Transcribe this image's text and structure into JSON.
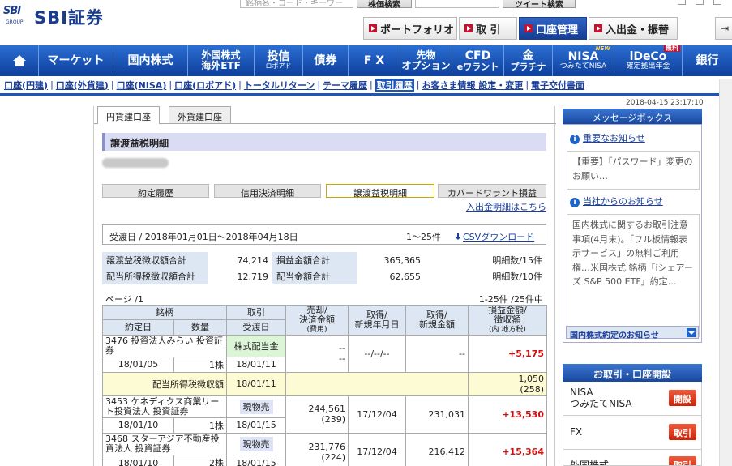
{
  "brand": {
    "logo_small": "SBI",
    "logo_group": "GROUP",
    "logo_text": "SBI証券"
  },
  "top_search": {
    "placeholder": "銘柄名・コード・キーワード",
    "button": "株価検索",
    "button2": "ツイート検索"
  },
  "subnav": {
    "portfolio": "ポートフォリオ",
    "trade": "取 引",
    "account": "口座管理",
    "deposit": "入出金・振替"
  },
  "mainnav": {
    "market": "マーケット",
    "domestic": "国内株式",
    "foreign_l1": "外国株式",
    "foreign_l2": "海外ETF",
    "trust_l1": "投信",
    "trust_l2": "ロボアド",
    "bond": "債券",
    "fx": "F X",
    "futures_l1": "先物",
    "futures_l2": "オプション",
    "cfd_l1": "CFD",
    "cfd_l2": "eワラント",
    "gold_l1": "金",
    "gold_l2": "プラチナ",
    "nisa_l1": "NISA",
    "nisa_l2": "つみたてNISA",
    "nisa_badge": "NEW",
    "ideco_l1": "iDeCo",
    "ideco_l2": "確定拠出年金",
    "ideco_badge": "無料",
    "bank": "銀行"
  },
  "acct_links": [
    "口座(円建)",
    "口座(外貨建)",
    "口座(NISA)",
    "口座(ロボアド)",
    "トータルリターン",
    "テーマ履歴",
    "取引履歴",
    "お客さま情報 設定・変更",
    "電子交付書面"
  ],
  "timestamp": "2018-04-15 23:17:10",
  "tabs": {
    "yen": "円貨建口座",
    "foreign": "外貨建口座"
  },
  "page_title": "譲渡益税明細",
  "segments": {
    "s1": "約定履歴",
    "s2": "信用決済明細",
    "s3": "譲渡益税明細",
    "s4": "カバードワラント損益"
  },
  "deposit_link": "入出金明細はこちら",
  "period": {
    "text": "受渡日 / 2018年01月01日～2018年04月18日",
    "count": "1～25件",
    "csv": "CSVダウンロード"
  },
  "summary": [
    {
      "label": "譲渡益税徴収額合計",
      "value": "74,214",
      "label2": "損益金額合計",
      "value2": "365,365",
      "label3": "明細数/15件"
    },
    {
      "label": "配当所得税徴収額合計",
      "value": "12,719",
      "label2": "配当金額合計",
      "value2": "62,655",
      "label3": "明細数/10件"
    }
  ],
  "page_left": "ページ /1",
  "page_right": "1-25件 /25件中",
  "table": {
    "h_name": "銘柄",
    "h_date": "約定日",
    "h_qty": "数量",
    "h_trade": "取引",
    "h_settle": "受渡日",
    "h_sell1": "売却/",
    "h_sell2": "決済金額",
    "h_sell3": "(費用)",
    "h_acq1": "取得/",
    "h_acq2": "新規年月日",
    "h_acqamt1": "取得/",
    "h_acqamt2": "新規金額",
    "h_pl1": "損益金額/",
    "h_pl2": "徴収額",
    "h_pl3": "(内 地方税)",
    "rows": [
      {
        "name": "3476 投資法人みらい 投資証券",
        "date": "18/01/05",
        "qty": "1株",
        "trade": "株式配当金",
        "settle": "18/01/11",
        "sell": "--",
        "sell_fee": "--",
        "acq_date": "--/--/--",
        "acq_amt": "--",
        "pl": "+5,175",
        "sub_label": "配当所得税徴収額",
        "sub_settle": "18/01/11",
        "sub_tax": "1,050",
        "sub_local": "(258)"
      },
      {
        "name": "3453 ケネディクス商業リート投資法人 投資証券",
        "date": "18/01/10",
        "qty": "1株",
        "trade": "現物売",
        "settle": "18/01/15",
        "sell": "244,561",
        "sell_fee": "(239)",
        "acq_date": "17/12/04",
        "acq_amt": "231,031",
        "pl": "+13,530"
      },
      {
        "name": "3468 スターアジア不動産投資法人 投資証券",
        "date": "18/01/10",
        "qty": "2株",
        "trade": "現物売",
        "settle": "18/01/15",
        "sell": "231,776",
        "sell_fee": "(224)",
        "acq_date": "17/12/04",
        "acq_amt": "216,412",
        "pl": "+15,364"
      }
    ]
  },
  "right": {
    "msgbox": "メッセージボックス",
    "important": "重要なお知らせ",
    "important_text": "【重要】「パスワード」変更のお願い…",
    "notice": "当社からのお知らせ",
    "notice_text": "国内株式に関するお取引注意事項(4月末)。「フル板情報表示サービス」の無料ご利用権…米国株式 銘柄「iシェアーズ S&P 500 ETF」約定…",
    "domestic_alert": "国内株式約定のお知らせ",
    "open_head": "お取引・口座開設",
    "nisa_l1": "NISA",
    "nisa_l2": "つみたてNISA",
    "nisa_btn": "開設",
    "fx": "FX",
    "fx_btn": "取引",
    "foreign": "外国株式",
    "foreign_btn": "取引"
  }
}
